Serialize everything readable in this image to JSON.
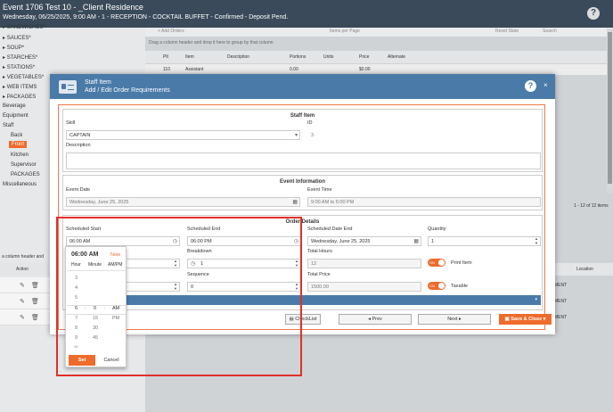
{
  "header": {
    "title": "Event 1706 Test 10 - _Client Residence",
    "subtitle": "Wednesday, 06/25/2025, 9:00 AM - 1 - RECEPTION - COCKTAIL BUFFET - Confirmed - Deposit Pend."
  },
  "sidebar": {
    "items": [
      {
        "label": "SANDWICHES*"
      },
      {
        "label": "SAUCES*"
      },
      {
        "label": "SOUP*"
      },
      {
        "label": "STARCHES*"
      },
      {
        "label": "STATIONS*"
      },
      {
        "label": "VEGETABLES*"
      },
      {
        "label": "WEB ITEMS"
      },
      {
        "label": "PACKAGES"
      },
      {
        "label": "Beverage"
      },
      {
        "label": "Equipment"
      },
      {
        "label": "Staff"
      },
      {
        "label": "Back"
      },
      {
        "label": "Front"
      },
      {
        "label": "Kitchen"
      },
      {
        "label": "Supervisor"
      },
      {
        "label": "PACKAGES"
      },
      {
        "label": "Miscellaneous"
      }
    ]
  },
  "grid": {
    "add_label": "+ Add Orders",
    "items_per_page": "Items per Page",
    "reset_state": "Reset State",
    "search_placeholder": "Search",
    "drag_hint": "Drag a column header and drop it here to group by that column",
    "columns": [
      "Plt",
      "Item",
      "Description",
      "Portions",
      "Units",
      "Price",
      "Alternate"
    ],
    "row": {
      "plt": "110",
      "item": "Assistant",
      "portions": "0.00",
      "price": "$0.00"
    },
    "pager": "1 - 12 of 12 items"
  },
  "lower_grid": {
    "hint": "a column header and",
    "action_header": "Action",
    "location_header": "Location",
    "location_value": "MENT"
  },
  "modal": {
    "title": "Staff Item",
    "subtitle": "Add / Edit Order Requirements",
    "help": "?",
    "close": "×",
    "staff_item": {
      "section_title": "Staff Item",
      "skill_label": "Skill",
      "skill_value": "CAPTAIN",
      "id_label": "ID",
      "id_value": "3",
      "description_label": "Description"
    },
    "event_info": {
      "section_title": "Event Information",
      "event_date_label": "Event Date",
      "event_date_value": "Wednesday, June 25, 2025",
      "event_time_label": "Event Time",
      "event_time_value": "9:00 AM to 5:00 PM"
    },
    "order_details": {
      "section_title": "Order Details",
      "scheduled_start_label": "Scheduled Start",
      "scheduled_start_value": "06:00 AM",
      "scheduled_end_label": "Scheduled End",
      "scheduled_end_value": "06:00 PM",
      "scheduled_date_end_label": "Scheduled Date End",
      "scheduled_date_end_value": "Wednesday, June 25, 2025",
      "quantity_label": "Quantity",
      "quantity_value": "1",
      "breakdown_label": "Breakdown",
      "breakdown_value": "1",
      "total_hours_label": "Total Hours",
      "total_hours_value": "12",
      "print_item_label": "Print Item",
      "sequence_label": "Sequence",
      "sequence_value": "0",
      "total_price_label": "Total Price",
      "total_price_value": "1500.00",
      "taxable_label": "Taxable",
      "toggle_on": "ON"
    },
    "buttons": {
      "checklist": "CheckList",
      "prev": "◂ Prev",
      "next": "Next",
      "save_close": "Save & Close"
    }
  },
  "time_picker": {
    "current": "06:00 AM",
    "now": "Now",
    "hour_header": "Hour",
    "minute_header": "Minute",
    "ampm_header": "AM/PM",
    "hours": [
      "3",
      "4",
      "5",
      "6",
      "7",
      "8",
      "9",
      "10"
    ],
    "minutes": [
      "0",
      "15",
      "30",
      "45"
    ],
    "ampm": [
      "AM",
      "PM"
    ],
    "set_label": "Set",
    "cancel_label": "Cancel"
  }
}
